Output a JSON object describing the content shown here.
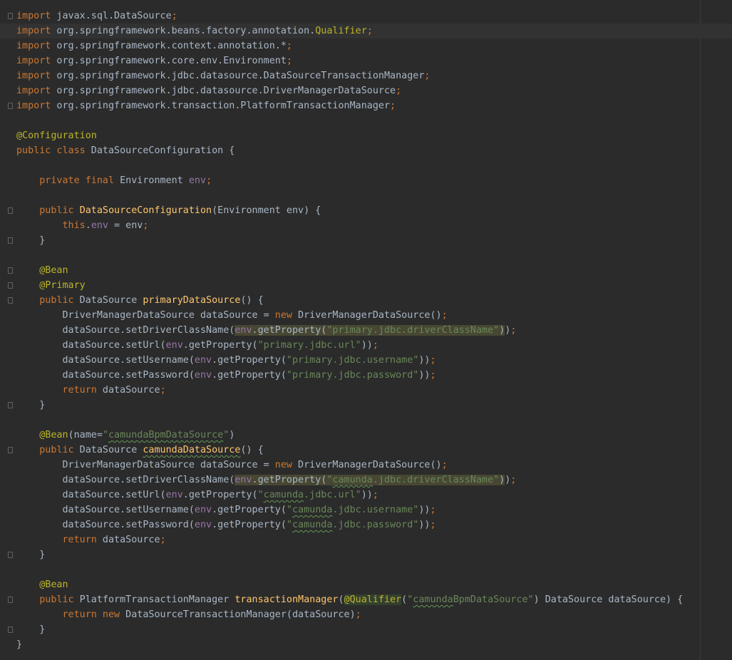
{
  "colors": {
    "background": "#2b2b2b",
    "current_line": "#323232",
    "plain": "#a9b7c6",
    "keyword": "#cc7832",
    "annotation": "#bbb529",
    "string": "#6a8759",
    "field": "#9876aa",
    "method_decl": "#ffc66d",
    "usage_highlight": "#474733"
  },
  "current_line_index": 1,
  "lines": [
    [
      {
        "t": "import",
        "c": "kw"
      },
      {
        "t": " javax.sql.DataSource"
      },
      {
        "t": ";",
        "c": "kw"
      }
    ],
    [
      {
        "t": "import",
        "c": "kw"
      },
      {
        "t": " org.springframework.beans.factory.annotation."
      },
      {
        "t": "Qualifier",
        "c": "ann"
      },
      {
        "t": ";",
        "c": "kw"
      }
    ],
    [
      {
        "t": "import",
        "c": "kw"
      },
      {
        "t": " org.springframework.context.annotation.*"
      },
      {
        "t": ";",
        "c": "kw"
      }
    ],
    [
      {
        "t": "import",
        "c": "kw"
      },
      {
        "t": " org.springframework.core.env.Environment"
      },
      {
        "t": ";",
        "c": "kw"
      }
    ],
    [
      {
        "t": "import",
        "c": "kw"
      },
      {
        "t": " org.springframework.jdbc.datasource.DataSourceTransactionManager"
      },
      {
        "t": ";",
        "c": "kw"
      }
    ],
    [
      {
        "t": "import",
        "c": "kw"
      },
      {
        "t": " org.springframework.jdbc.datasource.DriverManagerDataSource"
      },
      {
        "t": ";",
        "c": "kw"
      }
    ],
    [
      {
        "t": "import",
        "c": "kw"
      },
      {
        "t": " org.springframework.transaction.PlatformTransactionManager"
      },
      {
        "t": ";",
        "c": "kw"
      }
    ],
    [],
    [
      {
        "t": "@Configuration",
        "c": "ann"
      }
    ],
    [
      {
        "t": "public class",
        "c": "kw"
      },
      {
        "t": " DataSourceConfiguration {"
      }
    ],
    [],
    [
      {
        "t": "    "
      },
      {
        "t": "private final",
        "c": "kw"
      },
      {
        "t": " Environment "
      },
      {
        "t": "env",
        "c": "fld"
      },
      {
        "t": ";",
        "c": "kw"
      }
    ],
    [],
    [
      {
        "t": "    "
      },
      {
        "t": "public",
        "c": "kw"
      },
      {
        "t": " "
      },
      {
        "t": "DataSourceConfiguration",
        "c": "fn"
      },
      {
        "t": "(Environment env) {"
      }
    ],
    [
      {
        "t": "        "
      },
      {
        "t": "this",
        "c": "kw"
      },
      {
        "t": "."
      },
      {
        "t": "env",
        "c": "fld"
      },
      {
        "t": " = env"
      },
      {
        "t": ";",
        "c": "kw"
      }
    ],
    [
      {
        "t": "    }"
      }
    ],
    [],
    [
      {
        "t": "    "
      },
      {
        "t": "@Bean",
        "c": "ann"
      }
    ],
    [
      {
        "t": "    "
      },
      {
        "t": "@Primary",
        "c": "ann"
      }
    ],
    [
      {
        "t": "    "
      },
      {
        "t": "public",
        "c": "kw"
      },
      {
        "t": " DataSource "
      },
      {
        "t": "primaryDataSource",
        "c": "fn"
      },
      {
        "t": "() {"
      }
    ],
    [
      {
        "t": "        DriverManagerDataSource dataSource = "
      },
      {
        "t": "new",
        "c": "kw"
      },
      {
        "t": " DriverManagerDataSource()"
      },
      {
        "t": ";",
        "c": "kw"
      }
    ],
    [
      {
        "t": "        dataSource.setDriverClassName("
      },
      {
        "t": "env",
        "c": "fld hl"
      },
      {
        "t": ".getProperty(",
        "c": "hl"
      },
      {
        "t": "\"primary.jdbc.driverClassName\"",
        "c": "str hl"
      },
      {
        "t": ")",
        "c": "hl"
      },
      {
        "t": ")"
      },
      {
        "t": ";",
        "c": "kw"
      }
    ],
    [
      {
        "t": "        dataSource.setUrl("
      },
      {
        "t": "env",
        "c": "fld"
      },
      {
        "t": ".getProperty("
      },
      {
        "t": "\"primary.jdbc.url\"",
        "c": "str"
      },
      {
        "t": "))"
      },
      {
        "t": ";",
        "c": "kw"
      }
    ],
    [
      {
        "t": "        dataSource.setUsername("
      },
      {
        "t": "env",
        "c": "fld"
      },
      {
        "t": ".getProperty("
      },
      {
        "t": "\"primary.jdbc.username\"",
        "c": "str"
      },
      {
        "t": "))"
      },
      {
        "t": ";",
        "c": "kw"
      }
    ],
    [
      {
        "t": "        dataSource.setPassword("
      },
      {
        "t": "env",
        "c": "fld"
      },
      {
        "t": ".getProperty("
      },
      {
        "t": "\"primary.jdbc.password\"",
        "c": "str"
      },
      {
        "t": "))"
      },
      {
        "t": ";",
        "c": "kw"
      }
    ],
    [
      {
        "t": "        "
      },
      {
        "t": "return",
        "c": "kw"
      },
      {
        "t": " dataSource"
      },
      {
        "t": ";",
        "c": "kw"
      }
    ],
    [
      {
        "t": "    }"
      }
    ],
    [],
    [
      {
        "t": "    "
      },
      {
        "t": "@Bean",
        "c": "ann"
      },
      {
        "t": "(name="
      },
      {
        "t": "\"",
        "c": "str"
      },
      {
        "t": "camundaBpmDataSource",
        "c": "str typo"
      },
      {
        "t": "\"",
        "c": "str"
      },
      {
        "t": ")"
      }
    ],
    [
      {
        "t": "    "
      },
      {
        "t": "public",
        "c": "kw"
      },
      {
        "t": " DataSource "
      },
      {
        "t": "camundaDataSource",
        "c": "fn typo"
      },
      {
        "t": "() {"
      }
    ],
    [
      {
        "t": "        DriverManagerDataSource dataSource = "
      },
      {
        "t": "new",
        "c": "kw"
      },
      {
        "t": " DriverManagerDataSource()"
      },
      {
        "t": ";",
        "c": "kw"
      }
    ],
    [
      {
        "t": "        dataSource.setDriverClassName("
      },
      {
        "t": "env",
        "c": "fld hl"
      },
      {
        "t": ".getProperty(",
        "c": "hl"
      },
      {
        "t": "\"",
        "c": "str hl"
      },
      {
        "t": "camunda",
        "c": "str hl typo"
      },
      {
        "t": ".jdbc.driverClassName\"",
        "c": "str hl"
      },
      {
        "t": ")",
        "c": "hl"
      },
      {
        "t": ")"
      },
      {
        "t": ";",
        "c": "kw"
      }
    ],
    [
      {
        "t": "        dataSource.setUrl("
      },
      {
        "t": "env",
        "c": "fld"
      },
      {
        "t": ".getProperty("
      },
      {
        "t": "\"",
        "c": "str"
      },
      {
        "t": "camunda",
        "c": "str typo"
      },
      {
        "t": ".jdbc.url\"",
        "c": "str"
      },
      {
        "t": "))"
      },
      {
        "t": ";",
        "c": "kw"
      }
    ],
    [
      {
        "t": "        dataSource.setUsername("
      },
      {
        "t": "env",
        "c": "fld"
      },
      {
        "t": ".getProperty("
      },
      {
        "t": "\"",
        "c": "str"
      },
      {
        "t": "camunda",
        "c": "str typo"
      },
      {
        "t": ".jdbc.username\"",
        "c": "str"
      },
      {
        "t": "))"
      },
      {
        "t": ";",
        "c": "kw"
      }
    ],
    [
      {
        "t": "        dataSource.setPassword("
      },
      {
        "t": "env",
        "c": "fld"
      },
      {
        "t": ".getProperty("
      },
      {
        "t": "\"",
        "c": "str"
      },
      {
        "t": "camunda",
        "c": "str typo"
      },
      {
        "t": ".jdbc.password\"",
        "c": "str"
      },
      {
        "t": "))"
      },
      {
        "t": ";",
        "c": "kw"
      }
    ],
    [
      {
        "t": "        "
      },
      {
        "t": "return",
        "c": "kw"
      },
      {
        "t": " dataSource"
      },
      {
        "t": ";",
        "c": "kw"
      }
    ],
    [
      {
        "t": "    }"
      }
    ],
    [],
    [
      {
        "t": "    "
      },
      {
        "t": "@Bean",
        "c": "ann"
      }
    ],
    [
      {
        "t": "    "
      },
      {
        "t": "public",
        "c": "kw"
      },
      {
        "t": " PlatformTransactionManager "
      },
      {
        "t": "transactionManager",
        "c": "fn"
      },
      {
        "t": "("
      },
      {
        "t": "@Qualifier",
        "c": "ann hl2"
      },
      {
        "t": "("
      },
      {
        "t": "\"",
        "c": "str"
      },
      {
        "t": "camunda",
        "c": "str typo"
      },
      {
        "t": "BpmDataSource\"",
        "c": "str"
      },
      {
        "t": ") DataSource dataSource) {"
      }
    ],
    [
      {
        "t": "        "
      },
      {
        "t": "return new",
        "c": "kw"
      },
      {
        "t": " DataSourceTransactionManager(dataSource)"
      },
      {
        "t": ";",
        "c": "kw"
      }
    ],
    [
      {
        "t": "    }"
      }
    ],
    [
      {
        "t": "}"
      }
    ]
  ],
  "folds": [
    {
      "line": 0,
      "kind": "open"
    },
    {
      "line": 6,
      "kind": "close"
    },
    {
      "line": 13,
      "kind": "open"
    },
    {
      "line": 15,
      "kind": "close"
    },
    {
      "line": 17,
      "kind": "open"
    },
    {
      "line": 18,
      "kind": "open"
    },
    {
      "line": 19,
      "kind": "open"
    },
    {
      "line": 26,
      "kind": "close"
    },
    {
      "line": 29,
      "kind": "open"
    },
    {
      "line": 36,
      "kind": "close"
    },
    {
      "line": 39,
      "kind": "open"
    },
    {
      "line": 41,
      "kind": "close"
    }
  ]
}
